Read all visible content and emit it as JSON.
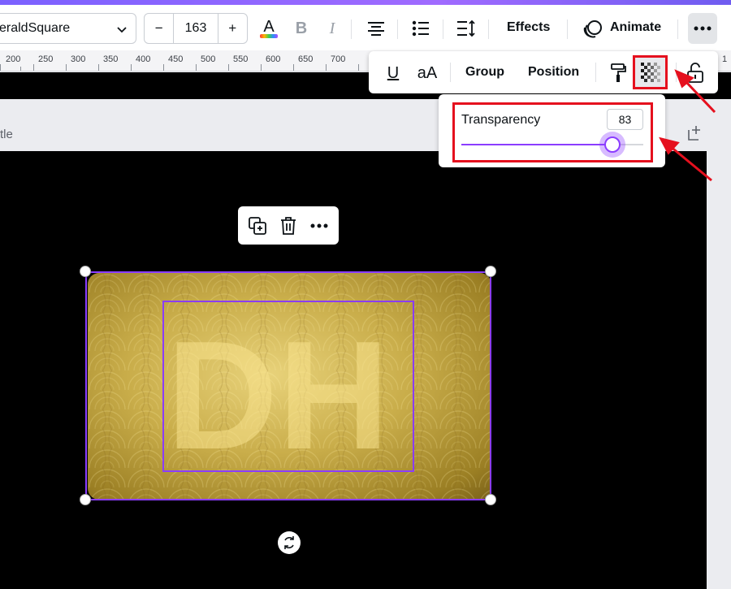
{
  "toolbar": {
    "font_name": "eraldSquare",
    "font_size": "163",
    "decrease_label": "−",
    "increase_label": "+",
    "effects_label": "Effects",
    "animate_label": "Animate",
    "text_color_glyph": "A",
    "bold_glyph": "B",
    "italic_glyph": "I"
  },
  "ruler": {
    "ticks": [
      "200",
      "250",
      "300",
      "350",
      "400",
      "450",
      "500",
      "550",
      "600",
      "650",
      "700",
      "1"
    ]
  },
  "sub_toolbar": {
    "underline_glyph": "U",
    "case_glyph": "aA",
    "group_label": "Group",
    "position_label": "Position"
  },
  "transparency": {
    "label": "Transparency",
    "value": "83",
    "level_percent": 83
  },
  "page": {
    "title_partial": "tle"
  },
  "design": {
    "monogram": "DH"
  },
  "colors": {
    "accent": "#8b3dff",
    "highlight": "#e5101e",
    "canvas": "#000000",
    "gold": "#c9ad4a"
  },
  "icons": [
    "chevron-down-icon",
    "text-color-icon",
    "align-center-icon",
    "list-icon",
    "spacing-icon",
    "animate-icon",
    "more-icon",
    "paint-roller-icon",
    "transparency-icon",
    "lock-icon",
    "copy-icon",
    "trash-icon",
    "rotate-icon",
    "add-page-icon"
  ]
}
